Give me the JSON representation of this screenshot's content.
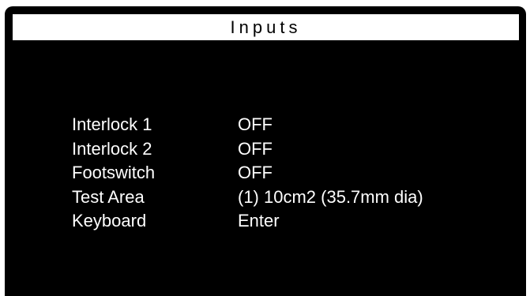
{
  "screen": {
    "title": "Inputs",
    "background_color": "#000000",
    "text_color": "#ffffff",
    "title_bar_color": "#ffffff"
  },
  "inputs": [
    {
      "label": "Interlock 1",
      "value": "OFF"
    },
    {
      "label": "Interlock 2",
      "value": "OFF"
    },
    {
      "label": "Footswitch",
      "value": "OFF"
    },
    {
      "label": "Test Area",
      "value": "(1) 10cm2 (35.7mm dia)"
    },
    {
      "label": "Keyboard",
      "value": "Enter"
    }
  ]
}
